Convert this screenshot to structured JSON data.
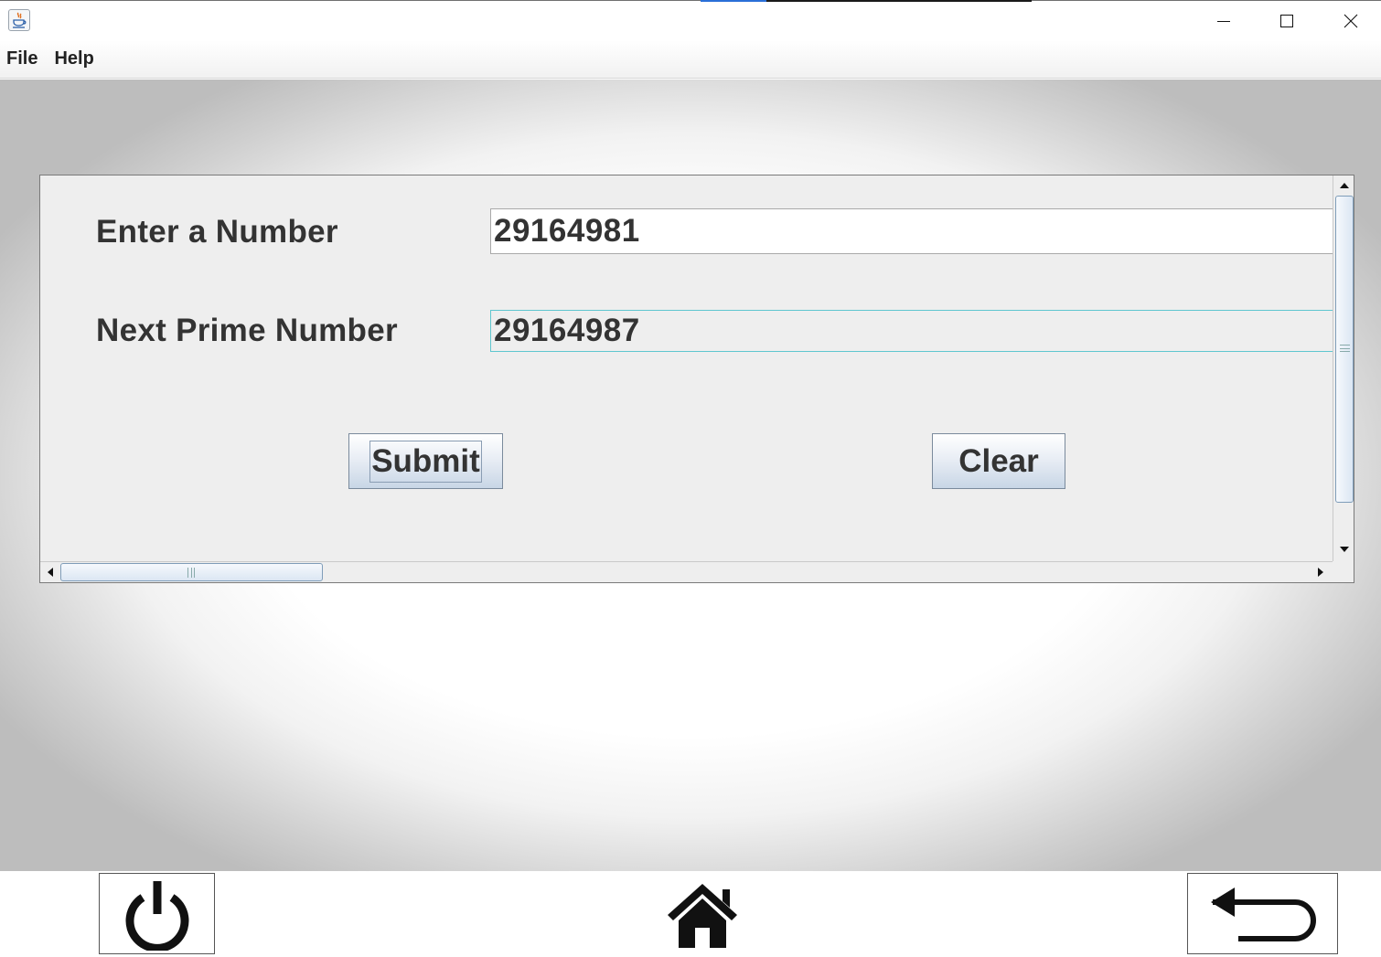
{
  "window": {
    "app_icon": "java-coffee-icon",
    "controls": {
      "minimize": "minimize-icon",
      "maximize": "maximize-icon",
      "close": "close-icon"
    }
  },
  "menu": {
    "items": [
      {
        "label": "File"
      },
      {
        "label": "Help"
      }
    ]
  },
  "form": {
    "number_label": "Enter a Number",
    "number_value": "29164981",
    "prime_label": "Next Prime Number",
    "prime_value": "29164987",
    "submit_label": "Submit",
    "clear_label": "Clear"
  },
  "nav": {
    "power_icon": "power-icon",
    "home_icon": "home-icon",
    "back_icon": "back-arrow-icon"
  },
  "colors": {
    "field_focus_border": "#5fc6cf",
    "button_gradient_bottom": "#c8d6e6",
    "title_accent": "#2a6fd8"
  }
}
